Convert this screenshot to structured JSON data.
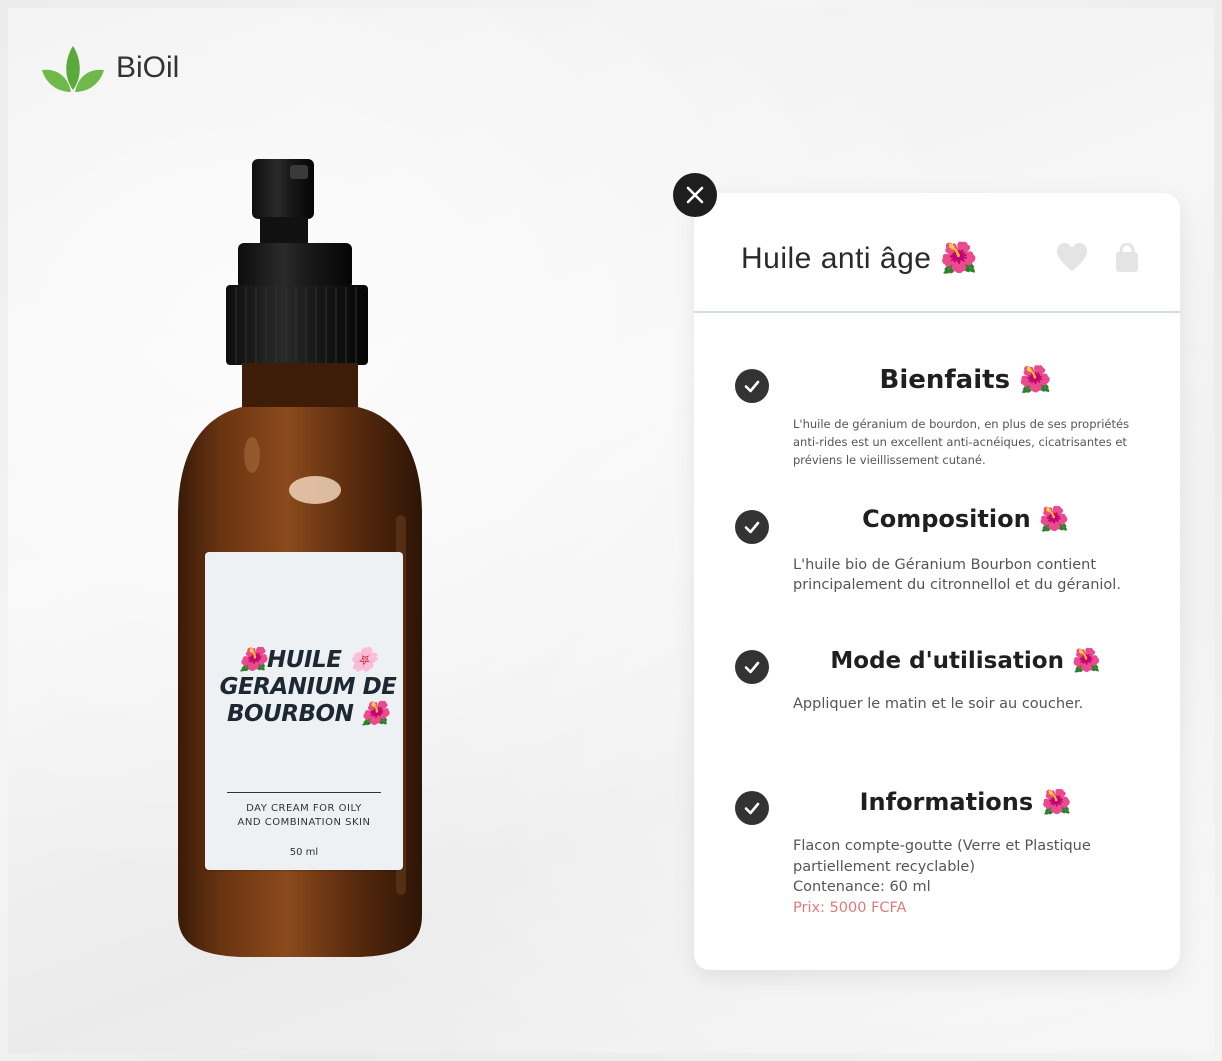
{
  "brand": {
    "name": "BiOil",
    "leaf_color": "#5aa93c"
  },
  "product_label": {
    "title_line1": "🌺HUILE 🌸",
    "title_line2": "GERANIUM DE",
    "title_line3": "BOURBON 🌺",
    "subtitle_line1": "DAY CREAM FOR OILY",
    "subtitle_line2": "AND COMBINATION SKIN",
    "volume": "50 ml"
  },
  "card": {
    "title": "Huile anti âge 🌺",
    "icons": [
      "close-icon",
      "heart-icon",
      "shopping-bag-icon"
    ],
    "sections": [
      {
        "title": "Bienfaits 🌺",
        "body": "L'huile de géranium de bourdon, en plus de ses propriétés anti-rides est un excellent anti-acnéiques, cicatrisantes et préviens le vieillissement cutané."
      },
      {
        "title": "Composition 🌺",
        "body": "L'huile bio de Géranium Bourbon contient principalement du citronnellol et du géraniol."
      },
      {
        "title": "Mode d'utilisation 🌺",
        "body": "Appliquer le matin et le soir au coucher."
      },
      {
        "title": "Informations 🌺",
        "body_line1": "Flacon compte-goutte (Verre et Plastique partiellement recyclable)",
        "body_line2": "Contenance: 60 ml",
        "price": "Prix: 5000 FCFA",
        "price_color": "#e07a7a"
      }
    ]
  }
}
